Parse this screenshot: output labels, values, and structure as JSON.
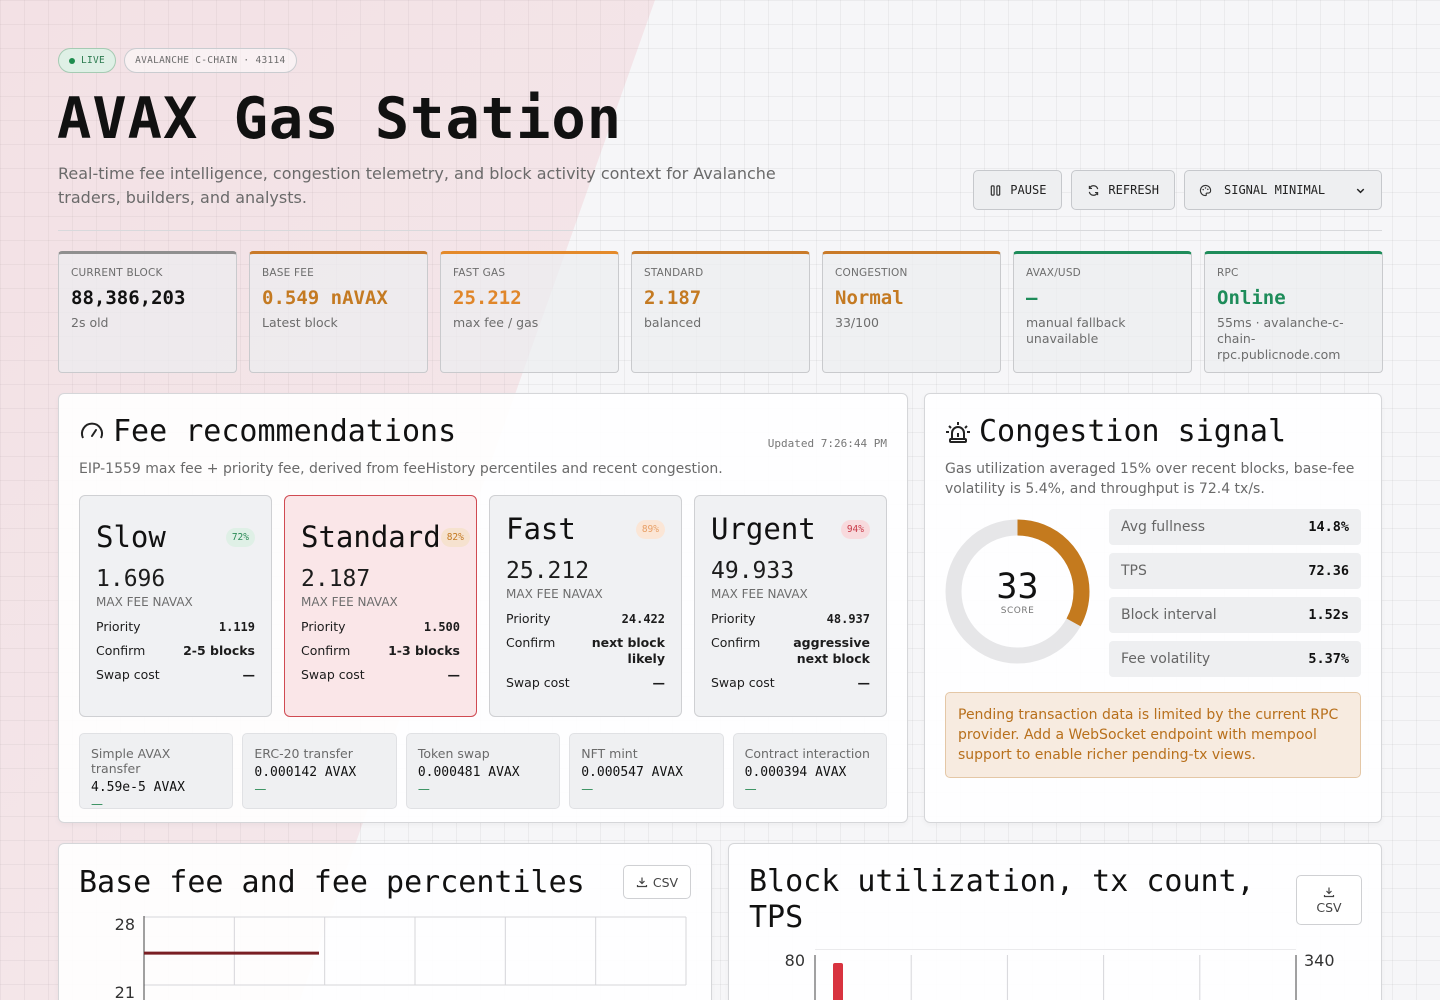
{
  "header": {
    "live_label": "LIVE",
    "chain_label": "AVALANCHE C-CHAIN · 43114",
    "title": "AVAX Gas Station",
    "subtitle": "Real-time fee intelligence, congestion telemetry, and block activity context for Avalanche traders, builders, and analysts."
  },
  "controls": {
    "pause_label": "PAUSE",
    "refresh_label": "REFRESH",
    "theme_value": "SIGNAL MINIMAL"
  },
  "stats": [
    {
      "label": "CURRENT BLOCK",
      "value": "88,386,203",
      "sub": "2s old",
      "accent": "#8f8f8f",
      "value_color": "#111111"
    },
    {
      "label": "BASE FEE",
      "value": "0.549 nAVAX",
      "sub": "Latest block",
      "accent": "#c97a28",
      "value_color": "#c47a22"
    },
    {
      "label": "FAST GAS",
      "value": "25.212",
      "sub": "max fee / gas",
      "accent": "#e48a2a",
      "value_color": "#e0862a"
    },
    {
      "label": "STANDARD",
      "value": "2.187",
      "sub": "balanced",
      "accent": "#c97a28",
      "value_color": "#c47a22"
    },
    {
      "label": "CONGESTION",
      "value": "Normal",
      "sub": "33/100",
      "accent": "#c97a28",
      "value_color": "#c47a22"
    },
    {
      "label": "AVAX/USD",
      "value": "—",
      "sub": "manual fallback unavailable",
      "accent": "#1e8c5a",
      "value_color": "#1e8c5a"
    },
    {
      "label": "RPC",
      "value": "Online",
      "sub": "55ms · avalanche-c-chain-rpc.publicnode.com",
      "accent": "#1e8c5a",
      "value_color": "#1e8c5a"
    }
  ],
  "fees": {
    "title": "Fee recommendations",
    "updated": "Updated 7:26:44 PM",
    "description": "EIP-1559 max fee + priority fee, derived from feeHistory percentiles and recent congestion.",
    "tiers": [
      {
        "name": "Slow",
        "pct": "72%",
        "value": "1.696",
        "unit": "MAX FEE NAVAX",
        "priority": "1.119",
        "confirm": "2-5 blocks",
        "swap": "—",
        "pct_bg": "#dff0e6",
        "pct_color": "#2a8a55"
      },
      {
        "name": "Standard",
        "pct": "82%",
        "value": "2.187",
        "unit": "MAX FEE NAVAX",
        "priority": "1.500",
        "confirm": "1-3 blocks",
        "swap": "—",
        "pct_bg": "#f6e2cf",
        "pct_color": "#c47a22"
      },
      {
        "name": "Fast",
        "pct": "89%",
        "value": "25.212",
        "unit": "MAX FEE NAVAX",
        "priority": "24.422",
        "confirm": "next block likely",
        "swap": "—",
        "pct_bg": "#fbe6d6",
        "pct_color": "#e8a067"
      },
      {
        "name": "Urgent",
        "pct": "94%",
        "value": "49.933",
        "unit": "MAX FEE NAVAX",
        "priority": "48.937",
        "confirm": "aggressive next block",
        "swap": "—",
        "pct_bg": "#f8dadd",
        "pct_color": "#c83a48"
      }
    ],
    "row_labels": {
      "priority": "Priority",
      "confirm": "Confirm",
      "swap": "Swap cost"
    },
    "tx_costs": [
      {
        "label": "Simple AVAX transfer",
        "value": "4.59e-5 AVAX",
        "usd": "—"
      },
      {
        "label": "ERC-20 transfer",
        "value": "0.000142 AVAX",
        "usd": "—"
      },
      {
        "label": "Token swap",
        "value": "0.000481 AVAX",
        "usd": "—"
      },
      {
        "label": "NFT mint",
        "value": "0.000547 AVAX",
        "usd": "—"
      },
      {
        "label": "Contract interaction",
        "value": "0.000394 AVAX",
        "usd": "—"
      }
    ]
  },
  "congestion": {
    "title": "Congestion signal",
    "description": "Gas utilization averaged 15% over recent blocks, base-fee volatility is 5.4%, and throughput is 72.4 tx/s.",
    "score": "33",
    "score_value": 33,
    "score_label": "SCORE",
    "metrics": [
      {
        "label": "Avg fullness",
        "value": "14.8%"
      },
      {
        "label": "TPS",
        "value": "72.36"
      },
      {
        "label": "Block interval",
        "value": "1.52s"
      },
      {
        "label": "Fee volatility",
        "value": "5.37%"
      }
    ],
    "notice": "Pending transaction data is limited by the current RPC provider. Add a WebSocket endpoint with mempool support to enable richer pending-tx views."
  },
  "charts": {
    "csv_label": "CSV",
    "base_fee_title": "Base fee and fee percentiles",
    "block_title": "Block utilization, tx count, TPS"
  },
  "chart_data": [
    {
      "type": "line",
      "title": "Base fee and fee percentiles",
      "y_ticks": [
        28,
        21
      ],
      "series": [
        {
          "values": [
            25,
            25,
            25
          ]
        }
      ]
    },
    {
      "type": "bar",
      "title": "Block utilization, tx count, TPS",
      "y_ticks_left": [
        80
      ],
      "y_ticks_right": [
        340
      ]
    }
  ]
}
